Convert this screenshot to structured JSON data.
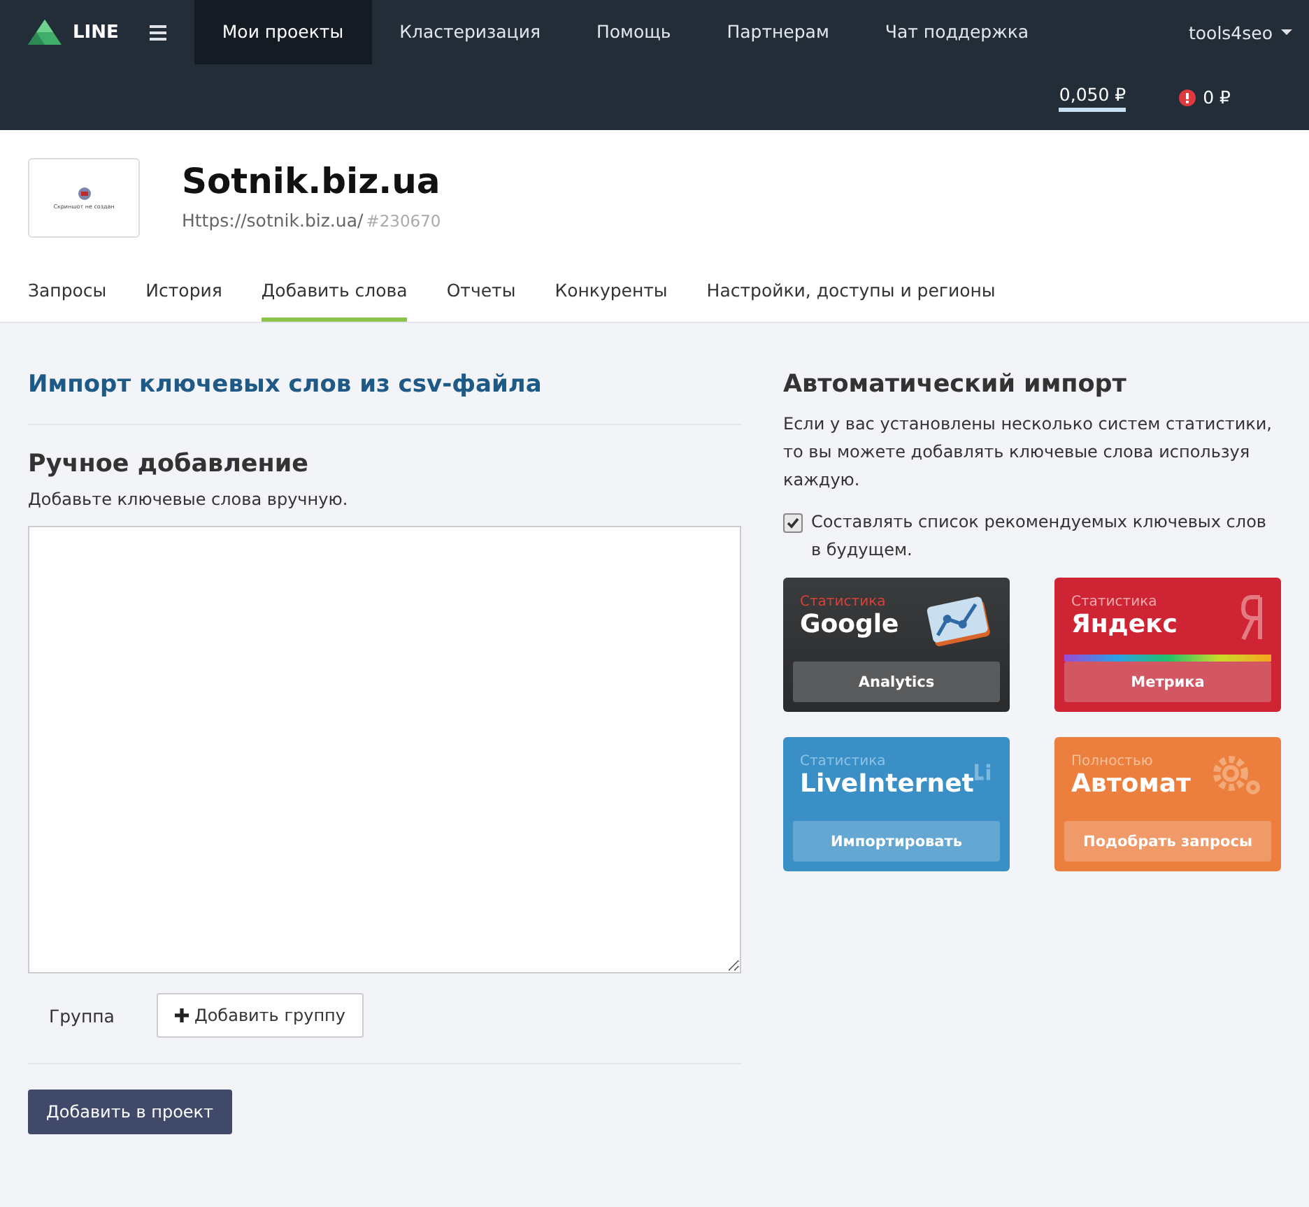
{
  "brand": "LINE",
  "nav": [
    {
      "label": "Мои проекты",
      "selected": true
    },
    {
      "label": "Кластеризация",
      "selected": false
    },
    {
      "label": "Помощь",
      "selected": false
    },
    {
      "label": "Партнерам",
      "selected": false
    },
    {
      "label": "Чат поддержка",
      "selected": false
    }
  ],
  "user": "tools4seo",
  "balance": "0,050 ₽",
  "debt": "0 ₽",
  "project": {
    "thumbnail_text": "Скриншот не создан",
    "name": "Sotnik.biz.ua",
    "url": "Https://sotnik.biz.ua/",
    "id": "#230670"
  },
  "tabs": [
    {
      "label": "Запросы",
      "selected": false
    },
    {
      "label": "История",
      "selected": false
    },
    {
      "label": "Добавить слова",
      "selected": true
    },
    {
      "label": "Отчеты",
      "selected": false
    },
    {
      "label": "Конкуренты",
      "selected": false
    },
    {
      "label": "Настройки, доступы и регионы",
      "selected": false
    }
  ],
  "import_link": "Импорт ключевых слов из csv-файла",
  "manual": {
    "title": "Ручное добавление",
    "hint": "Добавьте ключевые слова вручную.",
    "group_label": "Группа",
    "add_group": "Добавить группу",
    "submit": "Добавить в проект"
  },
  "auto": {
    "title": "Автоматический импорт",
    "text": "Если у вас установлены несколько систем статистики, то вы можете добавлять ключевые слова используя каждую.",
    "recommend": {
      "label": "Составлять список рекомендуемых ключевых слов в будущем.",
      "checked": true
    }
  },
  "cards": [
    {
      "kind": "google",
      "over": "Статистика",
      "title": "Google",
      "button": "Analytics"
    },
    {
      "kind": "yandex",
      "over": "Статистика",
      "title": "Яндекс",
      "button": "Метрика"
    },
    {
      "kind": "liveinternet",
      "over": "Статистика",
      "title": "LiveInternet",
      "button": "Импортировать"
    },
    {
      "kind": "auto",
      "over": "Полностью",
      "title": "Автомат",
      "button": "Подобрать запросы"
    }
  ]
}
